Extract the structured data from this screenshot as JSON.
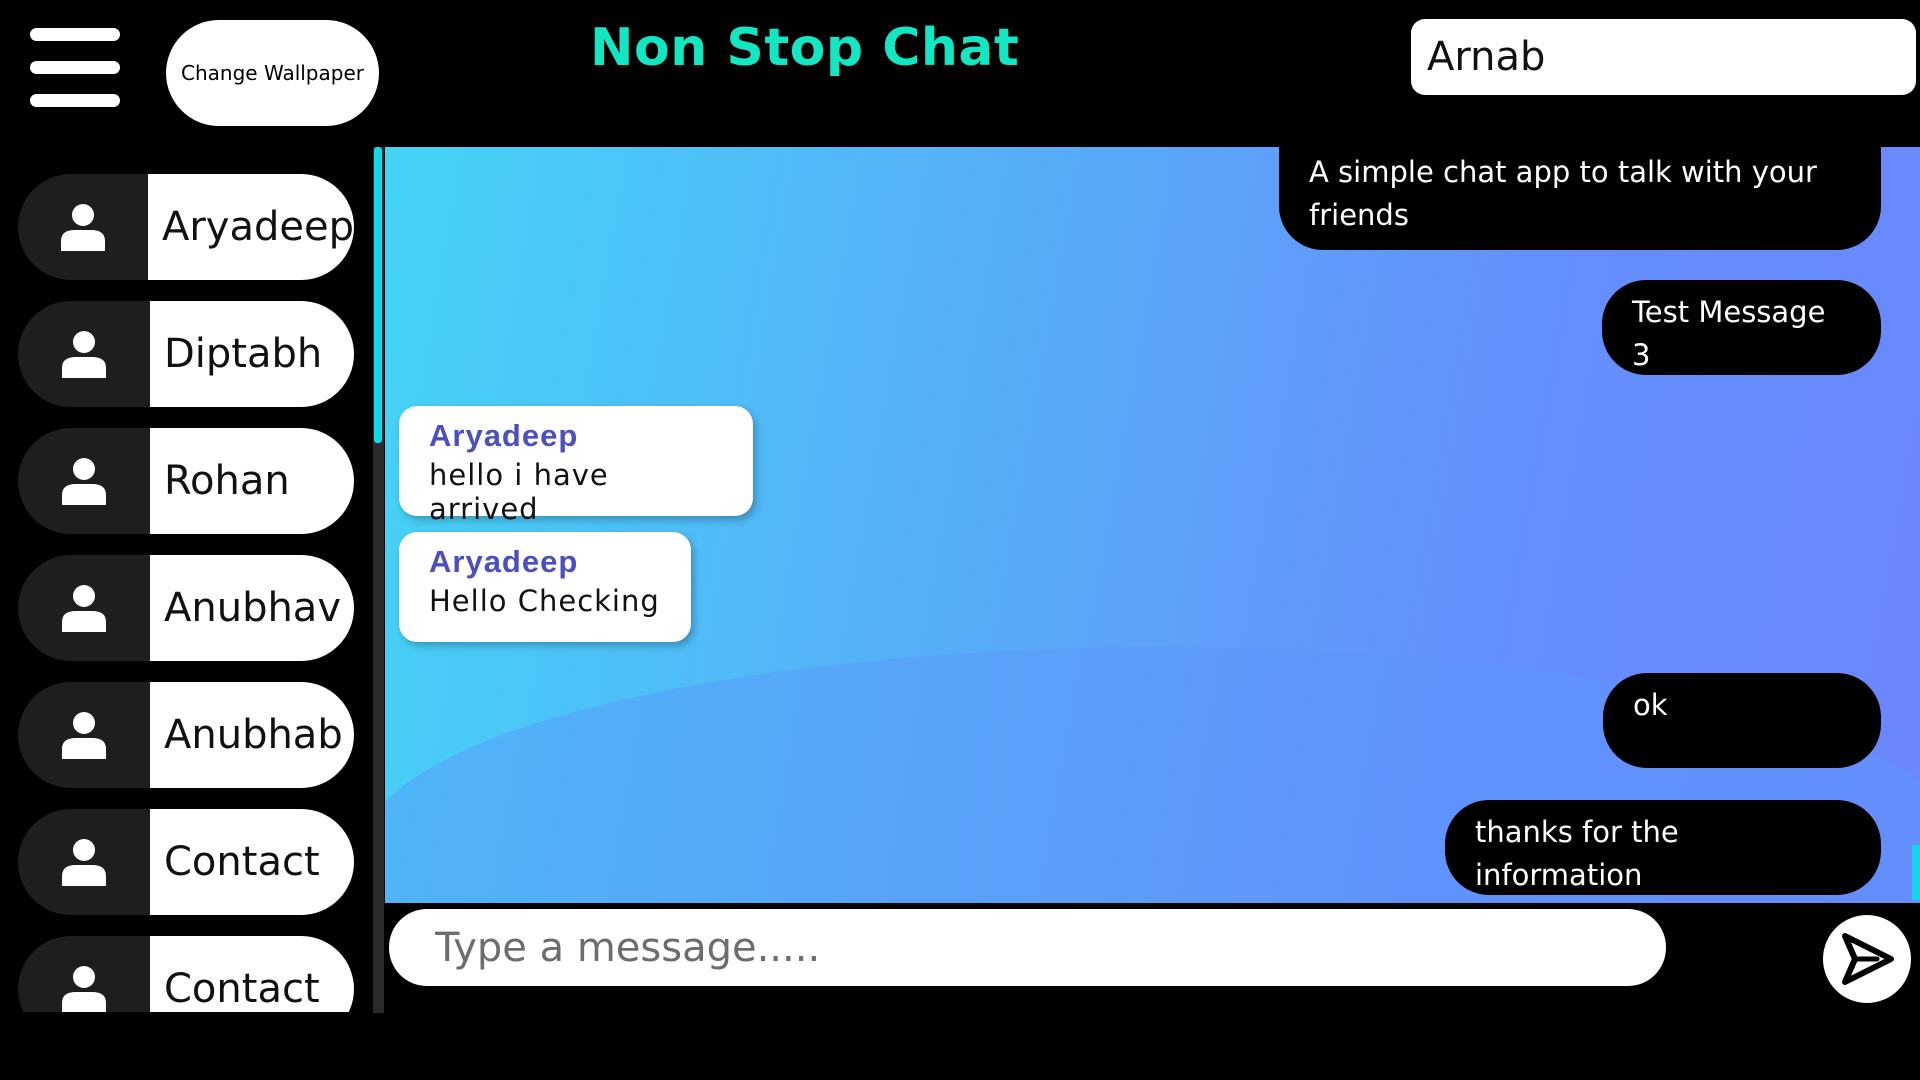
{
  "header": {
    "app_title": "Non Stop Chat",
    "change_wallpaper_label": "Change Wallpaper",
    "username": "Arnab",
    "menu_icon": "hamburger-icon"
  },
  "sidebar": {
    "avatar_icon": "user-icon",
    "contacts": [
      {
        "name": "Aryadeep"
      },
      {
        "name": "Diptabh"
      },
      {
        "name": "Rohan"
      },
      {
        "name": "Anubhav"
      },
      {
        "name": "Anubhab"
      },
      {
        "name": "Contact"
      },
      {
        "name": "Contact"
      }
    ]
  },
  "messages": [
    {
      "direction": "outgoing",
      "text": "A simple chat app to talk with your friends"
    },
    {
      "direction": "outgoing",
      "text": "Test Message 3"
    },
    {
      "direction": "incoming",
      "sender": "Aryadeep",
      "text": "hello i have arrived"
    },
    {
      "direction": "incoming",
      "sender": "Aryadeep",
      "text": "Hello Checking"
    },
    {
      "direction": "outgoing",
      "text": "ok"
    },
    {
      "direction": "outgoing",
      "text": "thanks for the information"
    }
  ],
  "composer": {
    "placeholder": "Type a message.....",
    "value": "",
    "send_icon": "send-icon"
  },
  "colors": {
    "title": "#12e6c3",
    "accent_scroll": "#0fd9e6",
    "sender_name": "#4b4fbf",
    "chat_gradient_start": "#44d4f6",
    "chat_gradient_end": "#6b87fc"
  }
}
